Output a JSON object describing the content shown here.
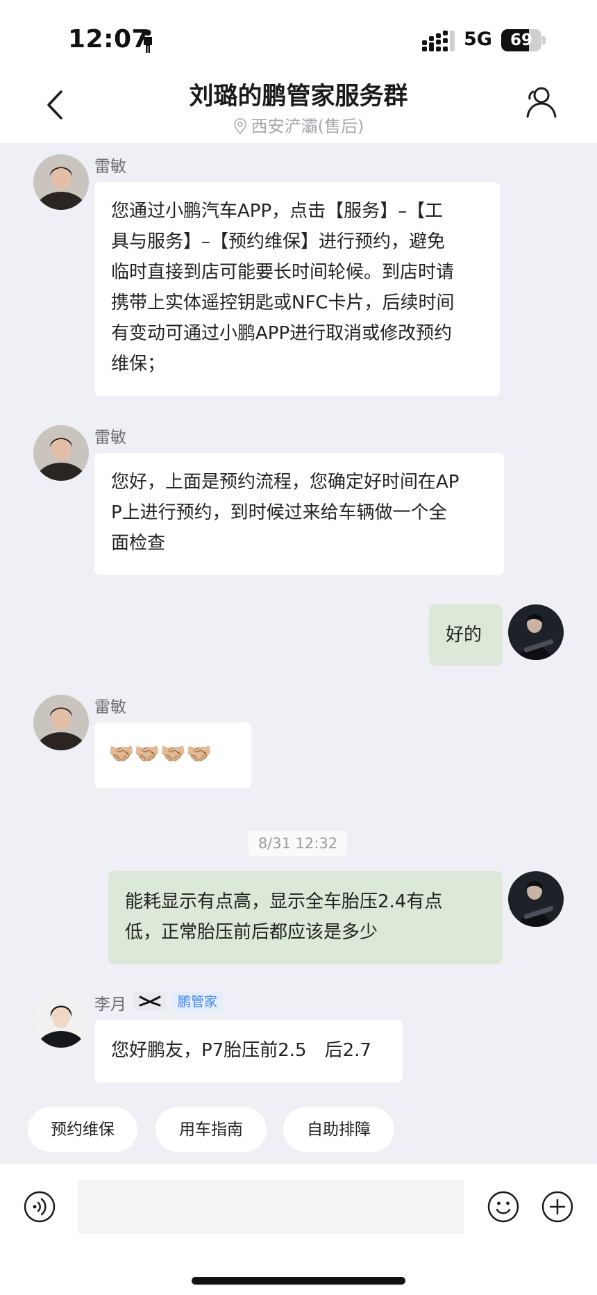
{
  "status_bar": {
    "time": "12:07",
    "network": "5G",
    "battery_level": "69",
    "battery_fraction": 0.69
  },
  "header": {
    "title": "刘璐的鹏管家服务群",
    "subtitle": "西安浐灞(售后)"
  },
  "messages": [
    {
      "sender": "雷敏",
      "own": false,
      "lines": [
        "您通过小鹏汽车APP，点击【服务】–【工",
        "具与服务】–【预约维保】进行预约，避免",
        "临时直接到店可能要长时间轮候。到店时请",
        "携带上实体遥控钥匙或NFC卡片，后续时间",
        "有变动可通过小鹏APP进行取消或修改预约",
        "维保；"
      ]
    },
    {
      "sender": "雷敏",
      "own": false,
      "lines": [
        "您好，上面是预约流程，您确定好时间在AP",
        "P上进行预约，到时候过来给车辆做一个全",
        "面检查"
      ]
    },
    {
      "sender": "",
      "own": true,
      "lines": [
        "好的"
      ]
    },
    {
      "sender": "雷敏",
      "own": false,
      "lines": [
        "🤝🏼🤝🏼🤝🏼🤝🏼"
      ]
    },
    {
      "sender": "",
      "own": true,
      "lines": [
        "能耗显示有点高，显示全车胎压2.4有点",
        "低，正常胎压前后都应该是多少"
      ]
    },
    {
      "sender": "李月",
      "own": false,
      "badge": "鹏管家",
      "lines": [
        "您好鹏友，P7胎压前2.5　后2.7"
      ]
    }
  ],
  "timestamp": "8/31 12:32",
  "quick_replies": [
    "预约维保",
    "用车指南",
    "自助排障"
  ],
  "icons": {
    "back": "chevron-left-icon",
    "members": "person-icon",
    "location": "location-pin-icon",
    "voice": "voice-icon",
    "emoji": "emoji-icon",
    "more": "plus-icon",
    "brand": "xpeng-logo-icon"
  },
  "colors": {
    "background": "#eef0f6",
    "own_bubble": "#dce9d8",
    "badge_text": "#3d88f0"
  }
}
